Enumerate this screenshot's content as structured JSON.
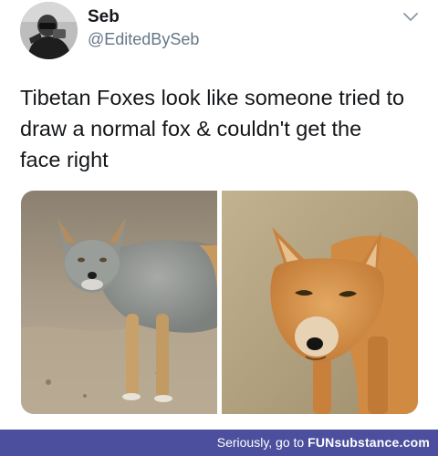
{
  "tweet": {
    "display_name": "Seb",
    "handle": "@EditedBySeb",
    "avatar_icon": "profile-photo-icon",
    "menu_icon": "chevron-down-icon",
    "text_lines": [
      "Tibetan Foxes look like someone tried to",
      "draw a normal fox & couldn't get the",
      "face right"
    ],
    "media": [
      {
        "subject": "grey-tibetan-fox-photo"
      },
      {
        "subject": "orange-tibetan-fox-face-photo"
      }
    ]
  },
  "footer": {
    "prefix": "Seriously, go to ",
    "brand": "FUNsubstance.com",
    "background": "#4c4f9e"
  }
}
